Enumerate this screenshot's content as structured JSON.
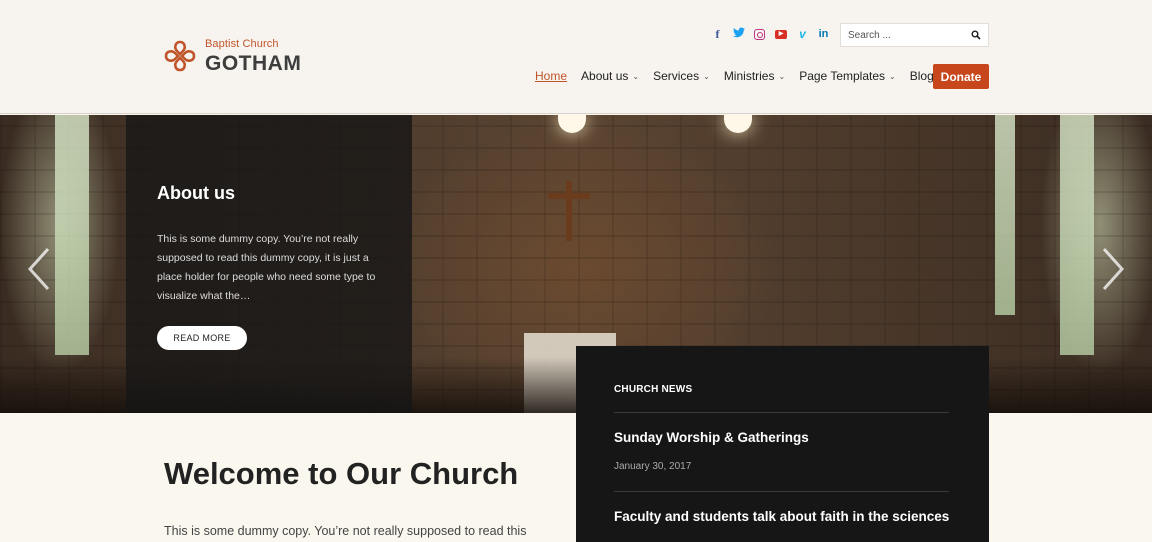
{
  "logo": {
    "subtitle": "Baptist Church",
    "title": "GOTHAM"
  },
  "socials": [
    {
      "icon": "facebook-icon",
      "glyph": "f",
      "color": "#3b5998"
    },
    {
      "icon": "twitter-icon",
      "glyph": "🐦",
      "color": "#1da1f2"
    },
    {
      "icon": "instagram-icon",
      "glyph": "",
      "color": "#c13584"
    },
    {
      "icon": "youtube-icon",
      "glyph": "▶",
      "color": "#d93025"
    },
    {
      "icon": "vimeo-icon",
      "glyph": "v",
      "color": "#1ab7ea"
    },
    {
      "icon": "linkedin-icon",
      "glyph": "in",
      "color": "#0077b5"
    }
  ],
  "search": {
    "placeholder": "Search ...",
    "icon": "search-icon"
  },
  "nav": {
    "items": [
      {
        "label": "Home",
        "active": true,
        "dropdown": false
      },
      {
        "label": "About us",
        "active": false,
        "dropdown": true
      },
      {
        "label": "Services",
        "active": false,
        "dropdown": true
      },
      {
        "label": "Ministries",
        "active": false,
        "dropdown": true
      },
      {
        "label": "Page Templates",
        "active": false,
        "dropdown": true
      },
      {
        "label": "Blog",
        "active": false,
        "dropdown": false
      }
    ],
    "donate_label": "Donate"
  },
  "hero": {
    "title": "About us",
    "text": "This is some dummy copy. You’re not really supposed to read this dummy copy, it is just a place holder for people who need some type to visualize what the…",
    "button_label": "READ MORE"
  },
  "main": {
    "heading": "Welcome to Our Church",
    "intro": "This is some dummy copy. You’re not really supposed to read this"
  },
  "news": {
    "heading": "CHURCH NEWS",
    "items": [
      {
        "title": "Sunday Worship & Gatherings",
        "date": "January 30, 2017"
      },
      {
        "title": "Faculty and students talk about faith in the sciences",
        "date": ""
      }
    ]
  },
  "colors": {
    "accent": "#c0552b",
    "donate": "#c8461b",
    "news_bg": "#161616"
  }
}
